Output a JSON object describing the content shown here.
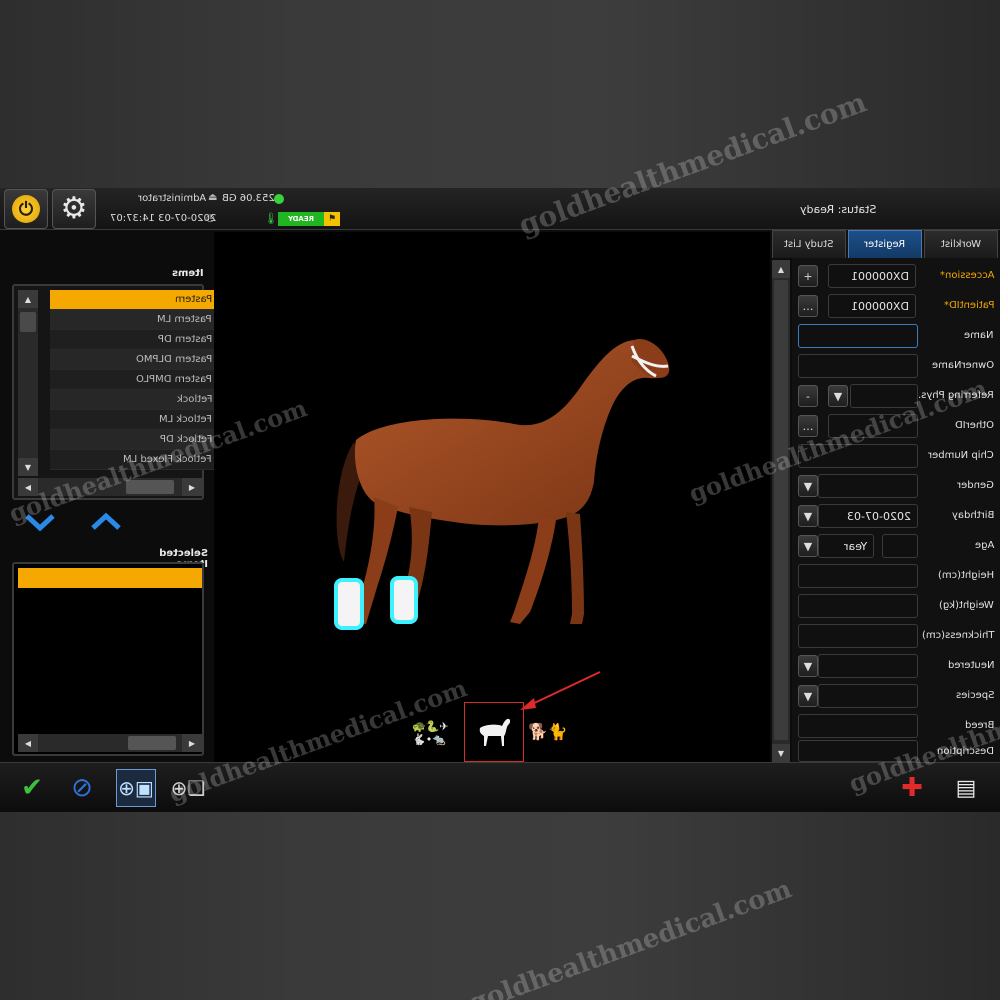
{
  "topbar": {
    "user": "Administrator",
    "disk_free": "253.06 GB",
    "datetime": "2020-07-03 14:37:07",
    "ready_label": "READY",
    "status": "Status: Ready"
  },
  "items_panel": {
    "title": "Items",
    "items": [
      "Pastern",
      "Pastern LM",
      "Pastern DP",
      "Pastern DLPMO",
      "Pastern DMPLO",
      "Fetlock",
      "Fetlock LM",
      "Fetlock DP",
      "Fetlock Flexed LM"
    ],
    "selected_index": 0
  },
  "selected_panel": {
    "title": "Selected Items"
  },
  "species_selector": {
    "small_animals": "🐢🐍✈\n🐇•🐀",
    "horse": "🐎",
    "dog": "🐕🐈",
    "active": "horse"
  },
  "tabs": [
    {
      "label": "Study List",
      "active": false
    },
    {
      "label": "Register",
      "active": true
    },
    {
      "label": "Worklist",
      "active": false
    }
  ],
  "form": {
    "accession_label": "Accession*",
    "accession_value": "DX000001",
    "patientid_label": "PatientID*",
    "patientid_value": "DX000001",
    "name_label": "Name",
    "name_value": "",
    "ownername_label": "OwnerName",
    "referring_label": "Referring Phys.",
    "otherid_label": "OtherID",
    "chip_label": "Chip Number",
    "gender_label": "Gender",
    "birthday_label": "Birthday",
    "birthday_value": "2020-07-03",
    "age_label": "Age",
    "age_unit": "Year",
    "height_label": "Height(cm)",
    "weight_label": "Weight(kg)",
    "thickness_label": "Thickness(cm)",
    "neutered_label": "Neutered",
    "species_label": "Species",
    "breed_label": "Breed",
    "description_label": "Description"
  },
  "watermark": "goldhealthmedical.com",
  "colors": {
    "accent_orange": "#f5a800",
    "tab_active": "#1d4f8a",
    "ready_green": "#22b522",
    "highlight_cyan": "#3ff0ff",
    "arrow_red": "#e02a2a"
  }
}
